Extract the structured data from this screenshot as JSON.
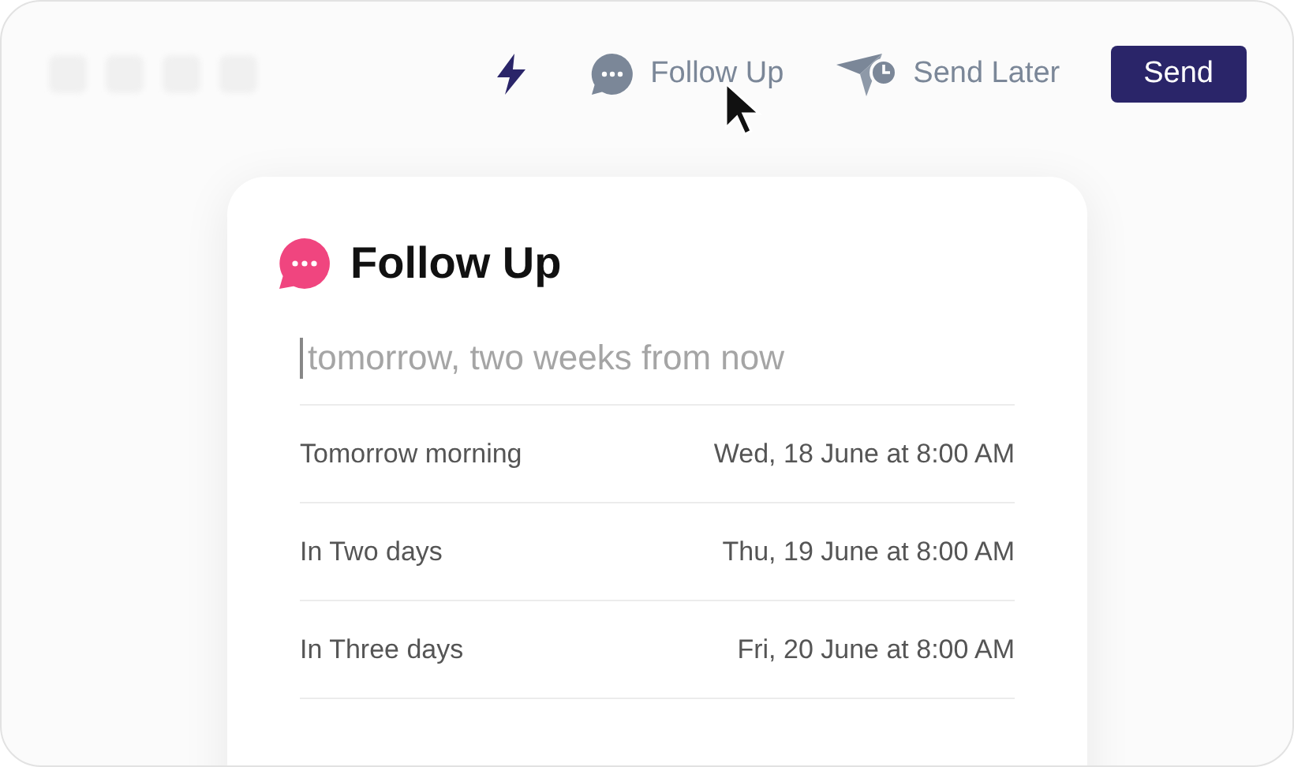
{
  "toolbar": {
    "follow_up": "Follow Up",
    "send_later": "Send Later",
    "send_button": "Send"
  },
  "follow_up_panel": {
    "title": "Follow Up",
    "search": {
      "placeholder": "tomorrow, two weeks from now"
    },
    "options": [
      {
        "label": "Tomorrow morning",
        "date": "Wed, 18 June at 8:00 AM"
      },
      {
        "label": "In Two days",
        "date": "Thu, 19 June at 8:00 AM"
      },
      {
        "label": "In Three days",
        "date": "Fri, 20 June at 8:00 AM"
      }
    ]
  }
}
